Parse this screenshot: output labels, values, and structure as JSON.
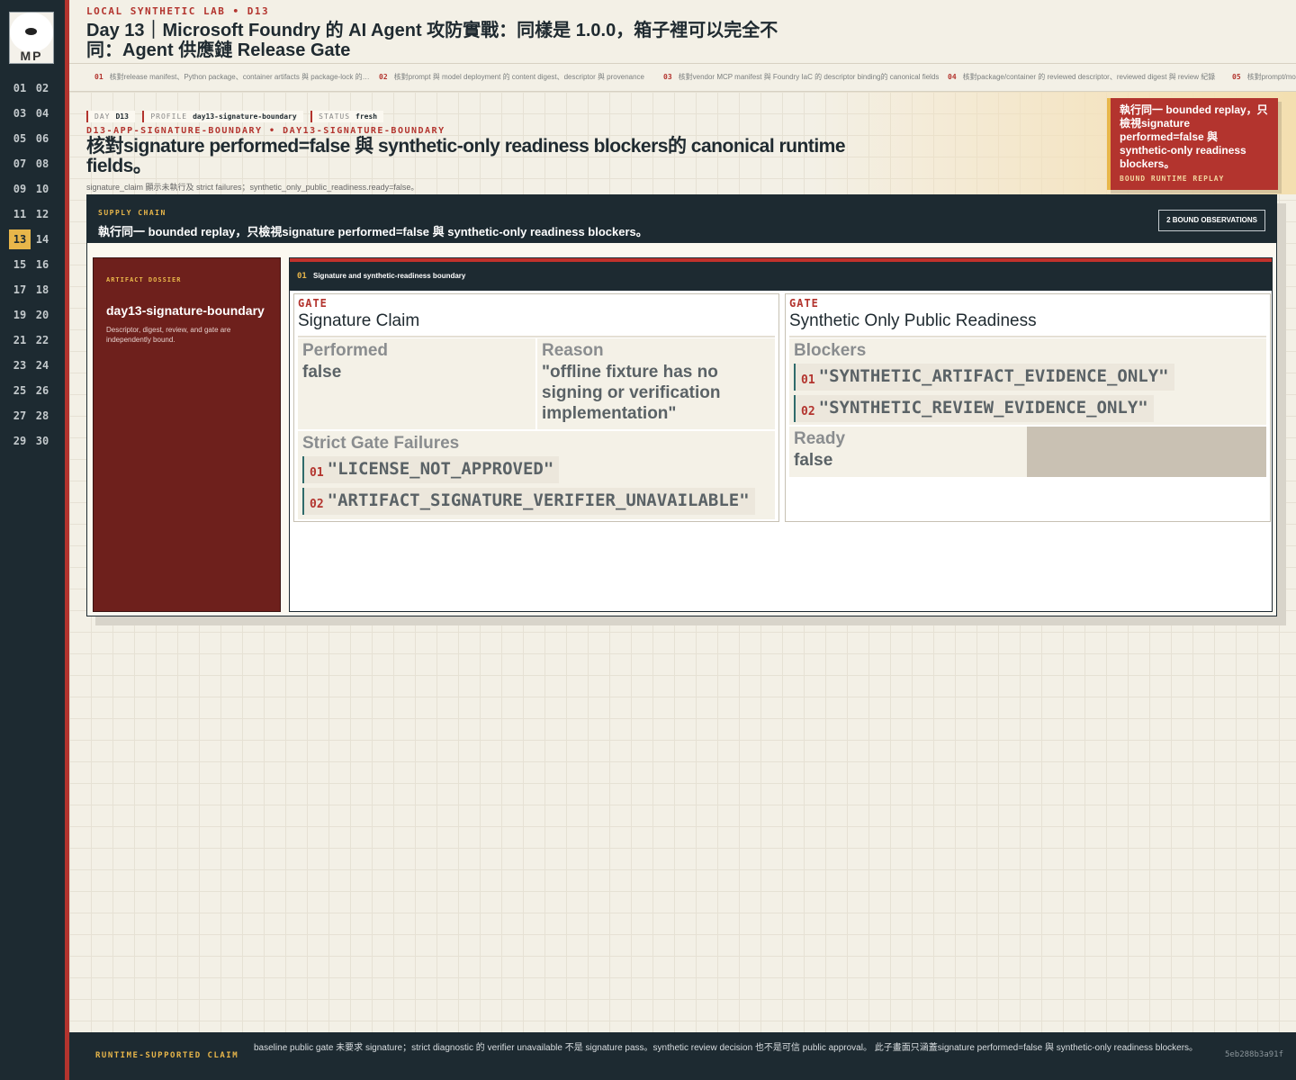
{
  "header": {
    "kicker": "LOCAL SYNTHETIC LAB • D13",
    "title": "Day 13｜Microsoft Foundry 的 AI Agent 攻防實戰：同樣是 1.0.0，箱子裡可以完全不同：Agent 供應鏈 Release Gate"
  },
  "logo": {
    "text": "MP"
  },
  "sidebar": {
    "days": [
      "01",
      "02",
      "03",
      "04",
      "05",
      "06",
      "07",
      "08",
      "09",
      "10",
      "11",
      "12",
      "13",
      "14",
      "15",
      "16",
      "17",
      "18",
      "19",
      "20",
      "21",
      "22",
      "23",
      "24",
      "25",
      "26",
      "27",
      "28",
      "29",
      "30"
    ],
    "active_day": "13"
  },
  "tabs": [
    {
      "num": "01",
      "label": "核對release manifest、Python package、container artifacts 與 package-lock 的 digest 一致性"
    },
    {
      "num": "02",
      "label": "核對prompt 與 model deployment 的 content digest、descriptor 與 provenance"
    },
    {
      "num": "03",
      "label": "核對vendor MCP manifest 與 Foundry IaC 的 descriptor binding的 canonical fields"
    },
    {
      "num": "04",
      "label": "核對package/container 的 reviewed descriptor、reviewed digest 與 review 紀錄"
    },
    {
      "num": "05",
      "label": "核對prompt/model"
    }
  ],
  "chips": [
    {
      "key": "DAY",
      "value": "D13"
    },
    {
      "key": "PROFILE",
      "value": "day13-signature-boundary"
    },
    {
      "key": "STATUS",
      "value": "fresh"
    }
  ],
  "hero": {
    "ids": "D13-APP-SIGNATURE-BOUNDARY • DAY13-SIGNATURE-BOUNDARY",
    "title": "核對signature performed=false 與 synthetic-only readiness blockers的 canonical runtime fields。",
    "subtitle": "signature_claim 顯示未執行及 strict failures；synthetic_only_public_readiness.ready=false。"
  },
  "replay_card": {
    "title": "執行同一 bounded replay，只檢視signature performed=false 與 synthetic-only readiness blockers。",
    "subtitle": "BOUND RUNTIME REPLAY"
  },
  "panel": {
    "kicker": "SUPPLY CHAIN",
    "title": "執行同一 bounded replay，只檢視signature performed=false 與 synthetic-only readiness blockers。",
    "obs_button": "2 BOUND OBSERVATIONS"
  },
  "dossier": {
    "kicker": "ARTIFACT DOSSIER",
    "name": "day13-signature-boundary",
    "desc": "Descriptor, digest, review, and gate are independently bound."
  },
  "detail": {
    "num": "01",
    "title": "Signature and synthetic-readiness boundary"
  },
  "gate_signature": {
    "kicker": "GATE",
    "title": "Signature Claim",
    "performed_label": "Performed",
    "performed_value": "false",
    "reason_label": "Reason",
    "reason_value": "\"offline fixture has no signing or verification implementation\"",
    "failures_label": "Strict Gate Failures",
    "failures": [
      {
        "num": "01",
        "value": "\"LICENSE_NOT_APPROVED\""
      },
      {
        "num": "02",
        "value": "\"ARTIFACT_SIGNATURE_VERIFIER_UNAVAILABLE\""
      }
    ]
  },
  "gate_readiness": {
    "kicker": "GATE",
    "title": "Synthetic Only Public Readiness",
    "blockers_label": "Blockers",
    "blockers": [
      {
        "num": "01",
        "value": "\"SYNTHETIC_ARTIFACT_EVIDENCE_ONLY\""
      },
      {
        "num": "02",
        "value": "\"SYNTHETIC_REVIEW_EVIDENCE_ONLY\""
      }
    ],
    "ready_label": "Ready",
    "ready_value": "false"
  },
  "footer": {
    "kicker": "RUNTIME-SUPPORTED CLAIM",
    "text": "baseline public gate 未要求 signature；strict diagnostic 的 verifier unavailable 不是 signature pass。synthetic review decision 也不是可信 public approval。 此子畫面只涵蓋signature performed=false 與 synthetic-only readiness blockers。",
    "hash": "5eb288b3a91f"
  },
  "colors": {
    "accent_red": "#b3342e",
    "accent_gold": "#e8b64a",
    "navy": "#1d2a31",
    "dossier": "#6e201c"
  }
}
